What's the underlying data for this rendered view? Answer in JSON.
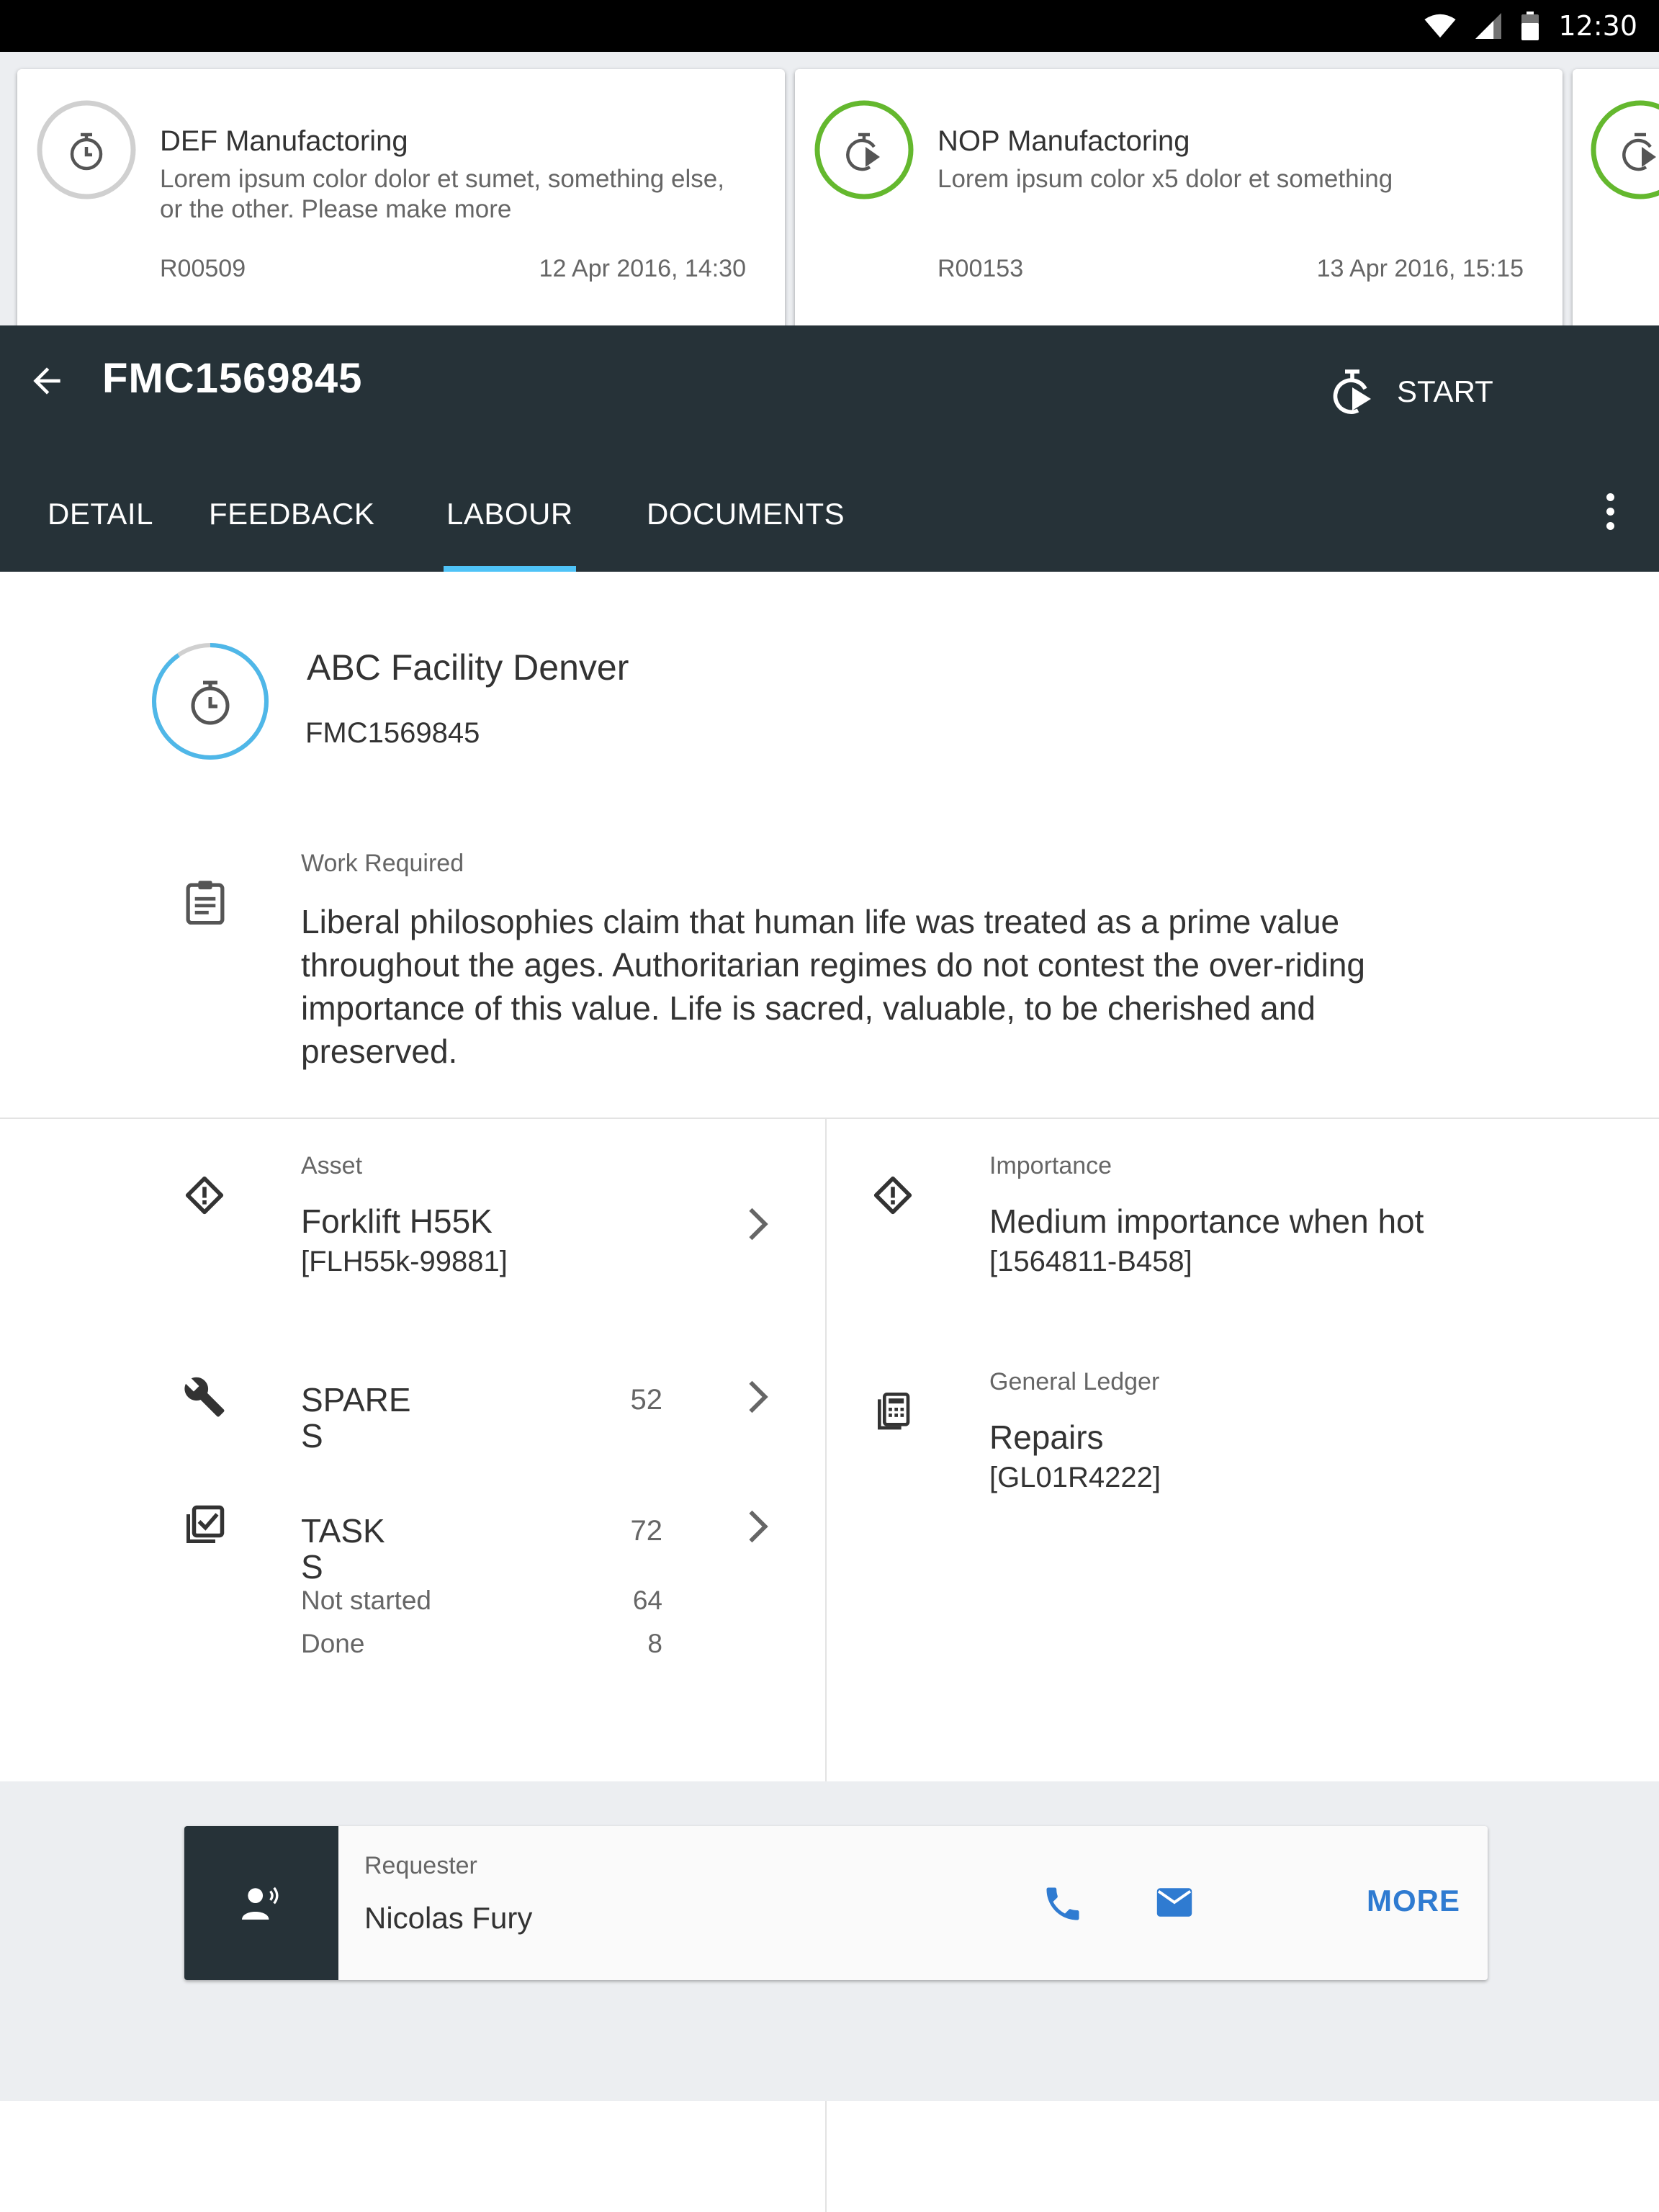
{
  "status_bar": {
    "time": "12:30"
  },
  "cards": [
    {
      "title": "DEF Manufactoring",
      "description": "Lorem ipsum color dolor et sumet, something else, or the other. Please make more",
      "id": "R00509",
      "date": "12 Apr 2016,  14:30",
      "progress_ring": "grey"
    },
    {
      "title": "NOP Manufactoring",
      "description": "Lorem ipsum color x5 dolor et something",
      "id": "R00153",
      "date": "13 Apr 2016,  15:15",
      "progress_ring": "green"
    }
  ],
  "header": {
    "title": "FMC1569845",
    "start_label": "START",
    "tabs": [
      {
        "label": "DETAIL",
        "active": false
      },
      {
        "label": "FEEDBACK",
        "active": false
      },
      {
        "label": "LABOUR",
        "active": true
      },
      {
        "label": "DOCUMENTS",
        "active": false
      }
    ]
  },
  "facility": {
    "name": "ABC Facility Denver",
    "code": "FMC1569845"
  },
  "work_required": {
    "label": "Work Required",
    "text": "Liberal philosophies claim that human life was treated as a prime value throughout the ages. Authoritarian regimes do not contest the over-riding importance of this value. Life is sacred, valuable, to be cherished and preserved."
  },
  "asset": {
    "label": "Asset",
    "name": "Forklift H55K",
    "code": "[FLH55k-99881]"
  },
  "spares": {
    "label_line1": "SPARE",
    "label_line2": "S",
    "count": "52"
  },
  "tasks": {
    "label_line1": "TASK",
    "label_line2": "S",
    "count": "72",
    "breakdown": [
      {
        "label": "Not started",
        "count": "64"
      },
      {
        "label": "Done",
        "count": "8"
      }
    ]
  },
  "importance": {
    "label": "Importance",
    "value": "Medium importance when hot",
    "code": "[1564811-B458]"
  },
  "general_ledger": {
    "label": "General Ledger",
    "value": "Repairs",
    "code": "[GL01R4222]"
  },
  "requester": {
    "label": "Requester",
    "name": "Nicolas Fury",
    "more_label": "MORE"
  },
  "colors": {
    "header_bg": "#263238",
    "tab_indicator": "#4fc3f7",
    "accent_blue": "#2f7bd1",
    "ring_green": "#64b82e",
    "ring_grey": "#d0d0d0"
  }
}
